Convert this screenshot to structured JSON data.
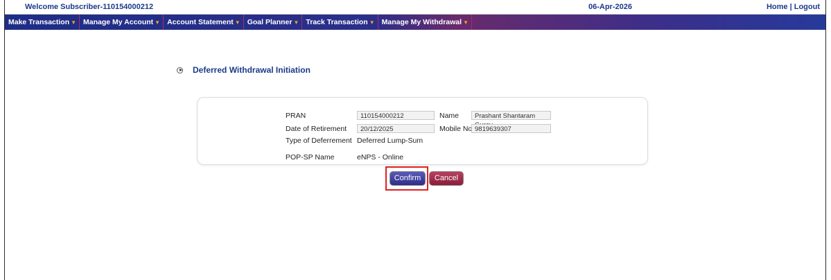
{
  "header": {
    "welcome": "Welcome Subscriber-110154000212",
    "date": "06-Apr-2026",
    "home_link": "Home",
    "separator": " | ",
    "logout_link": "Logout"
  },
  "nav": {
    "items": [
      {
        "label": "Make Transaction"
      },
      {
        "label": "Manage My Account"
      },
      {
        "label": "Account Statement"
      },
      {
        "label": "Goal Planner"
      },
      {
        "label": "Track Transaction"
      },
      {
        "label": "Manage My Withdrawal"
      }
    ],
    "caret": "▼"
  },
  "page": {
    "title": "Deferred Withdrawal Initiation"
  },
  "form": {
    "pran_label": "PRAN",
    "pran_value": "110154000212",
    "name_label": "Name",
    "name_value": "Prashant Shantaram Gurav",
    "dor_label": "Date of Retirement",
    "dor_value": "20/12/2025",
    "mobile_label": "Mobile No",
    "mobile_value": "9819639307",
    "deferment_label": "Type of Deferrement",
    "deferment_value": "Deferred Lump-Sum",
    "popsp_label": "POP-SP Name",
    "popsp_value": "eNPS - Online"
  },
  "actions": {
    "confirm_label": "Confirm",
    "cancel_label": "Cancel"
  },
  "colors": {
    "accent": "#1a3a8a",
    "nav_caret": "#f2a020",
    "highlight": "#e02020"
  }
}
